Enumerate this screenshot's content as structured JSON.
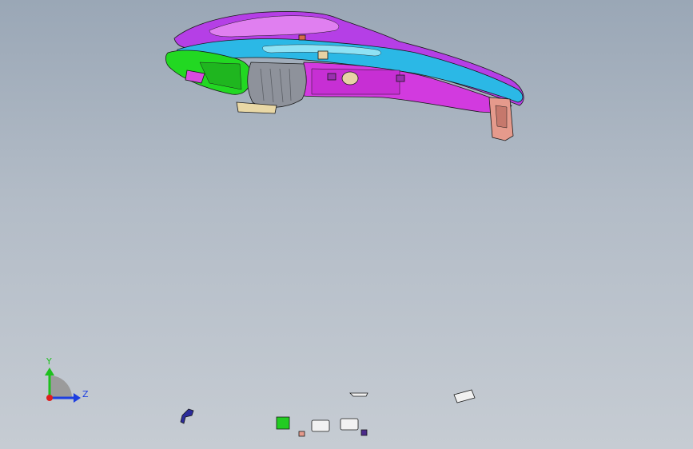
{
  "viewport": {
    "background_top": "#9aa7b6",
    "background_bottom": "#c6ccd3"
  },
  "model": {
    "colors": {
      "magenta": "#cc33dd",
      "magenta_light": "#e57ff0",
      "purple": "#8a2be2",
      "cyan": "#27b6e0",
      "cyan_light": "#7fdcf0",
      "green": "#22dd22",
      "gray": "#8a8e98",
      "tan": "#e8d7a8",
      "salmon": "#e79a8c",
      "outline": "#1a1a1a"
    }
  },
  "triad": {
    "y_label": "Y",
    "z_label": "Z",
    "y_color": "#1ec01e",
    "z_color": "#1e3fe0",
    "x_color": "#e01e1e"
  },
  "loose_parts": [
    {
      "name": "small-bracket-part",
      "icon": "bracket-icon"
    },
    {
      "name": "flat-strip-part",
      "icon": "strip-icon"
    },
    {
      "name": "clip-part",
      "icon": "clip-icon"
    },
    {
      "name": "green-plate-part",
      "icon": "plate-icon"
    },
    {
      "name": "nut-part",
      "icon": "nut-icon"
    },
    {
      "name": "connector-part-1",
      "icon": "connector-icon"
    },
    {
      "name": "connector-part-2",
      "icon": "connector-icon"
    },
    {
      "name": "cap-part",
      "icon": "cap-icon"
    }
  ]
}
